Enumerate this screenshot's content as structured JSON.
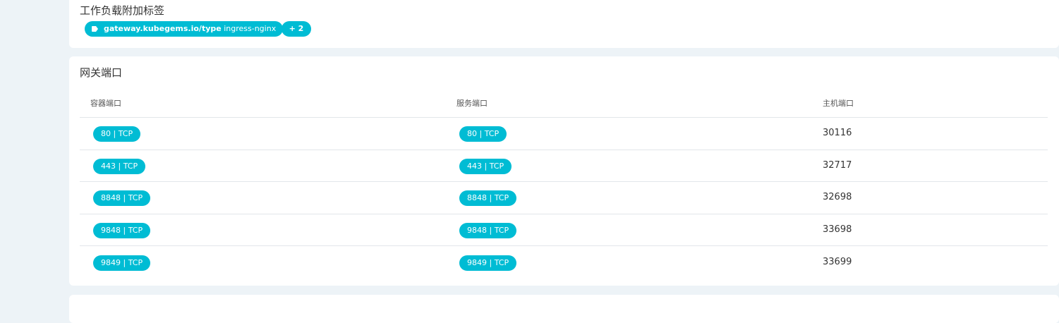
{
  "workload_labels": {
    "title": "工作负载附加标签",
    "label": {
      "key": "gateway.kubegems.io/type",
      "value": "ingress-nginx",
      "icon": "tag-icon"
    },
    "more": "+ 2"
  },
  "gateway_ports": {
    "title": "网关端口",
    "columns": [
      "容器端口",
      "服务端口",
      "主机端口"
    ],
    "rows": [
      {
        "container": "80 | TCP",
        "service": "80 | TCP",
        "host": "30116"
      },
      {
        "container": "443 | TCP",
        "service": "443 | TCP",
        "host": "32717"
      },
      {
        "container": "8848 | TCP",
        "service": "8848 | TCP",
        "host": "32698"
      },
      {
        "container": "9848 | TCP",
        "service": "9848 | TCP",
        "host": "33698"
      },
      {
        "container": "9849 | TCP",
        "service": "9849 | TCP",
        "host": "33699"
      }
    ]
  },
  "colors": {
    "accent": "#00bcd4",
    "background": "#edf3f7",
    "card": "#ffffff"
  }
}
